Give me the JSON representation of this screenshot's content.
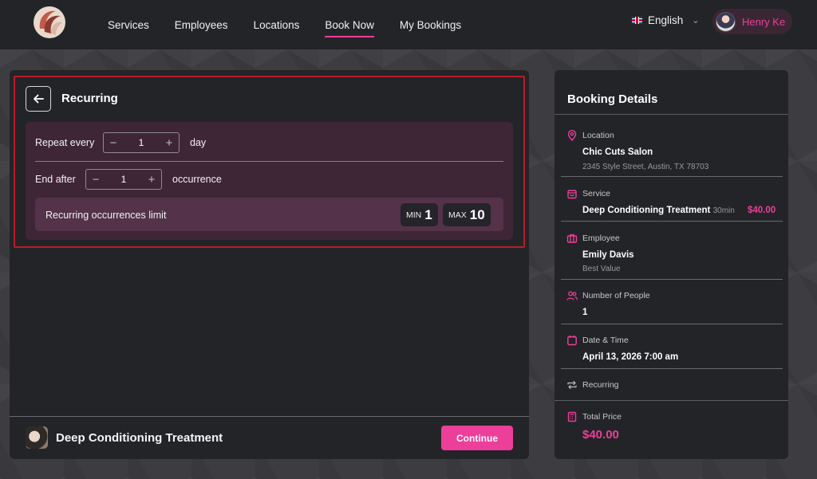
{
  "header": {
    "nav": [
      {
        "label": "Services"
      },
      {
        "label": "Employees"
      },
      {
        "label": "Locations"
      },
      {
        "label": "Book Now",
        "active": true
      },
      {
        "label": "My Bookings"
      }
    ],
    "language": "English",
    "user_name": "Henry Ke"
  },
  "recurring": {
    "title": "Recurring",
    "repeat_label": "Repeat every",
    "repeat_value": "1",
    "repeat_unit": "day",
    "end_label": "End after",
    "end_value": "1",
    "end_unit": "occurrence",
    "limit_label": "Recurring occurrences limit",
    "min_label": "MIN",
    "min_value": "1",
    "max_label": "MAX",
    "max_value": "10"
  },
  "footer": {
    "service_name": "Deep Conditioning Treatment",
    "continue_label": "Continue"
  },
  "details": {
    "title": "Booking Details",
    "location_label": "Location",
    "location_name": "Chic Cuts Salon",
    "location_address": "2345 Style Street, Austin, TX 78703",
    "service_label": "Service",
    "service_name": "Deep Conditioning Treatment",
    "service_duration": "30min",
    "service_price": "$40.00",
    "employee_label": "Employee",
    "employee_name": "Emily Davis",
    "employee_note": "Best Value",
    "people_label": "Number of People",
    "people_value": "1",
    "datetime_label": "Date & Time",
    "datetime_value": "April 13, 2026  7:00 am",
    "recurring_label": "Recurring",
    "total_label": "Total Price",
    "total_value": "$40.00"
  },
  "colors": {
    "accent": "#ec3f9a",
    "panel": "#232428",
    "recurring_bg": "#3e2637"
  }
}
